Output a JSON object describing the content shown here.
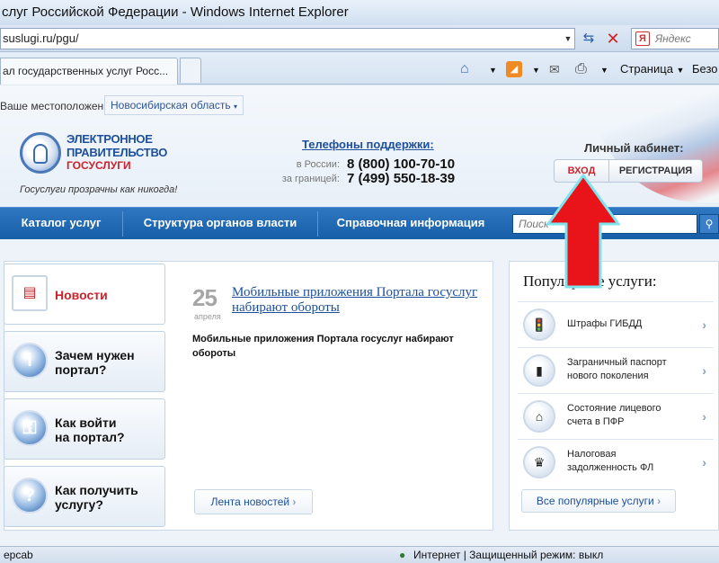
{
  "window": {
    "title": "слуг Российской Федерации - Windows Internet Explorer"
  },
  "address": {
    "url": "suslugi.ru/pgu/"
  },
  "search_box": {
    "placeholder": "Яндекс"
  },
  "tab": {
    "label": "ал государственных услуг Росс..."
  },
  "commands": {
    "page": "Страница",
    "safety": "Безо"
  },
  "location": {
    "label": "Ваше местоположение:",
    "region": "Новосибирская область"
  },
  "logo": {
    "line1": "ЭЛЕКТРОННОЕ",
    "line2": "ПРАВИТЕЛЬСТВО",
    "line3": "ГОСУСЛУГИ",
    "slogan": "Госуслуги прозрачны как никогда!"
  },
  "support": {
    "title": "Телефоны поддержки",
    "rows": [
      {
        "label": "в России:",
        "number": "8 (800) 100-70-10"
      },
      {
        "label": "за границей:",
        "number": "7 (499) 550-18-39"
      }
    ]
  },
  "cabinet": {
    "title": "Личный кабинет:",
    "login": "ВХОД",
    "register": "РЕГИСТРАЦИЯ"
  },
  "nav": {
    "items": [
      "Каталог услуг",
      "Структура органов власти",
      "Справочная информация"
    ],
    "search_placeholder": "Поиск"
  },
  "sidebar": {
    "items": [
      {
        "label1": "Новости",
        "label2": ""
      },
      {
        "label1": "Зачем нужен",
        "label2": "портал?"
      },
      {
        "label1": "Как войти",
        "label2": "на портал?"
      },
      {
        "label1": "Как получить",
        "label2": "услугу?"
      }
    ]
  },
  "news": {
    "day": "25",
    "month": "апреля",
    "title": "Мобильные приложения Портала госуслуг набирают обороты",
    "text": "Мобильные приложения Портала госуслуг набирают обороты",
    "more": "Лента новостей"
  },
  "popular": {
    "title": "Популярные услуги:",
    "items": [
      {
        "line1": "Штрафы ГИБДД",
        "line2": ""
      },
      {
        "line1": "Заграничный паспорт",
        "line2": "нового поколения"
      },
      {
        "line1": "Состояние лицевого",
        "line2": "счета в ПФР"
      },
      {
        "line1": "Налоговая",
        "line2": "задолженность ФЛ"
      }
    ],
    "all": "Все популярные услуги"
  },
  "status": {
    "left": "ерсаb",
    "right": "Интернет | Защищенный режим: выкл"
  },
  "colors": {
    "accent": "#1d4f9a",
    "brand_red": "#c9242b",
    "nav_blue": "#175ea8",
    "arrow": "#e8141a"
  }
}
